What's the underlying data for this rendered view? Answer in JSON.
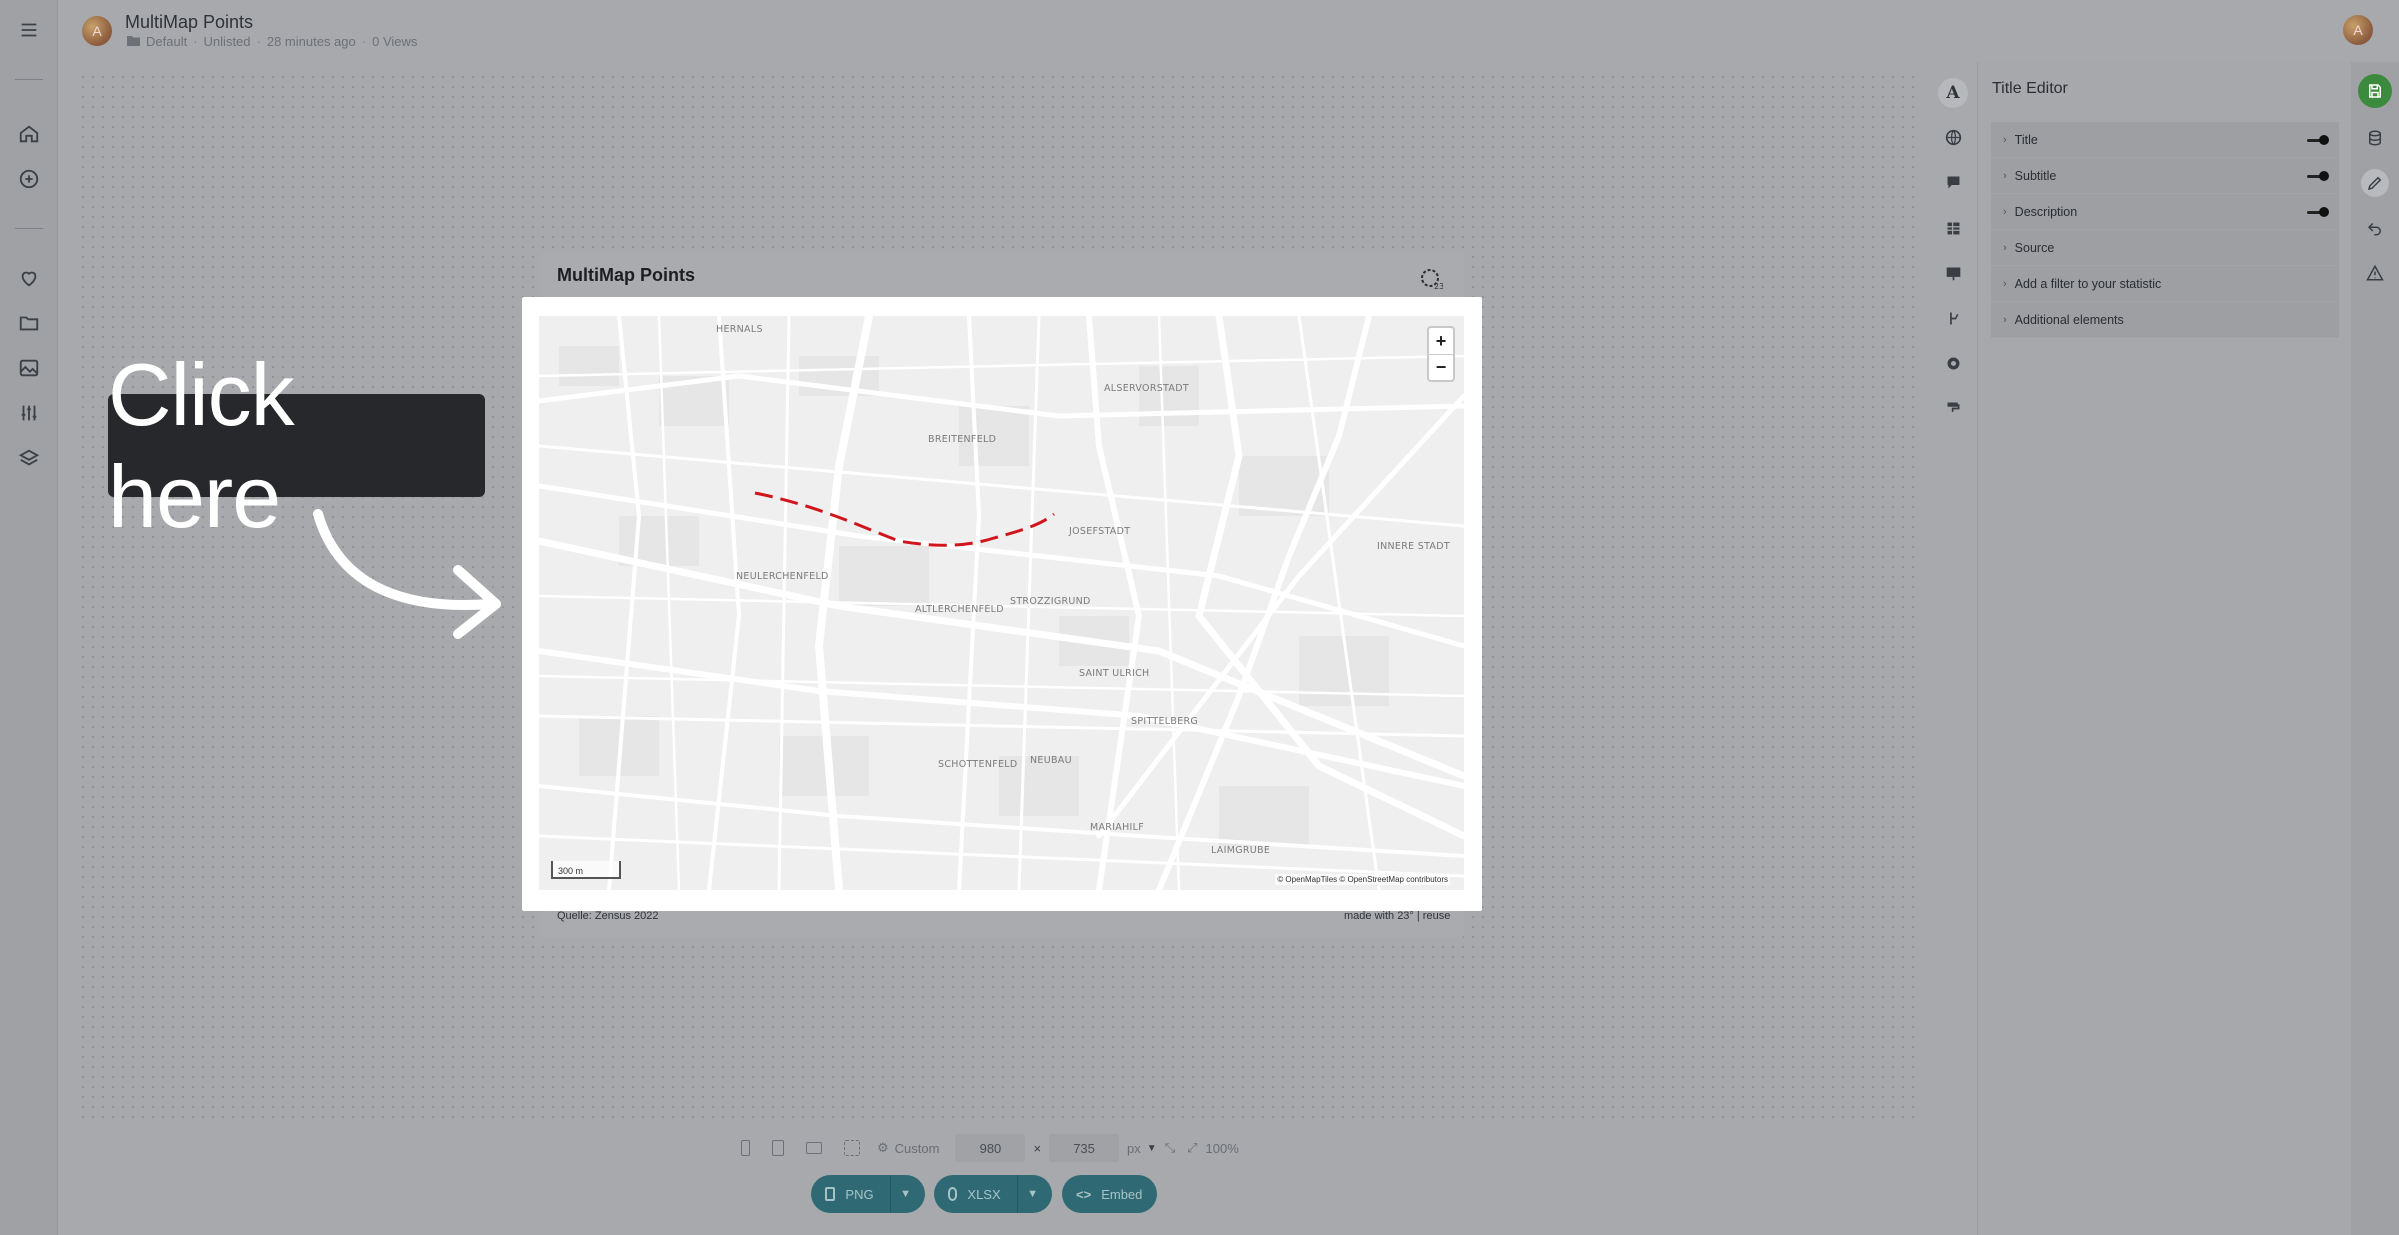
{
  "app": {
    "user_initial": "A"
  },
  "header": {
    "title": "MultiMap Points",
    "folder": "Default",
    "visibility": "Unlisted",
    "edited": "28 minutes ago",
    "views": "0 Views"
  },
  "chart": {
    "title": "MultiMap Points",
    "source": "Quelle: Zensus 2022",
    "made_with": "made with 23° | reuse",
    "zoom_in": "+",
    "zoom_out": "−",
    "scale": "300 m",
    "attribution": "© OpenMapTiles © OpenStreetMap contributors",
    "route_color": "#d0161c",
    "labels": [
      {
        "name": "district-hernals",
        "text": "HERNALS"
      },
      {
        "name": "district-alservorstadt",
        "text": "ALSERVORSTADT"
      },
      {
        "name": "district-breitenfeld",
        "text": "BREITENFELD"
      },
      {
        "name": "district-josefstadt",
        "text": "JOSEFSTADT"
      },
      {
        "name": "district-innere-stadt",
        "text": "INNERE STADT"
      },
      {
        "name": "district-neulerchenfeld",
        "text": "NEULERCHENFELD"
      },
      {
        "name": "district-altlerchenfeld",
        "text": "ALTLERCHENFELD"
      },
      {
        "name": "district-strozzigrund",
        "text": "STROZZIGRUND"
      },
      {
        "name": "district-sankt-ulrich",
        "text": "SAINT ULRICH"
      },
      {
        "name": "district-spittelberg",
        "text": "SPITTELBERG"
      },
      {
        "name": "district-schottenfeld",
        "text": "SCHOTTENFELD"
      },
      {
        "name": "district-neubau",
        "text": "NEUBAU"
      },
      {
        "name": "district-mariahilf",
        "text": "MARIAHILF"
      },
      {
        "name": "district-laimgrube",
        "text": "LAIMGRUBE"
      }
    ]
  },
  "callout": {
    "text": "Click here"
  },
  "editor": {
    "title": "Title Editor",
    "rows": [
      {
        "label": "Title",
        "toggle": true
      },
      {
        "label": "Subtitle",
        "toggle": true
      },
      {
        "label": "Description",
        "toggle": true
      },
      {
        "label": "Source",
        "toggle": false
      },
      {
        "label": "Add a filter to your statistic",
        "toggle": false
      },
      {
        "label": "Additional elements",
        "toggle": false
      }
    ]
  },
  "rail": {
    "text_icon": "A"
  },
  "size_bar": {
    "preset": "Custom",
    "width": "980",
    "times": "×",
    "height": "735",
    "unit": "px",
    "zoom": "100%"
  },
  "export": {
    "png": "PNG",
    "xlsx": "XLSX",
    "embed": "Embed"
  }
}
